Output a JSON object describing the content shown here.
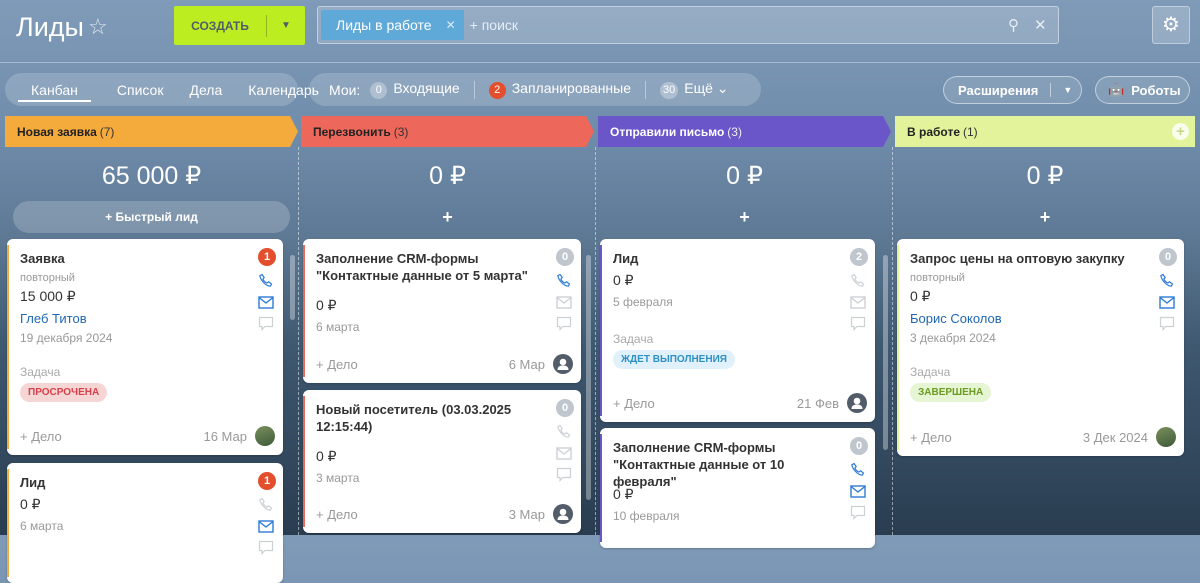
{
  "header": {
    "title": "Лиды",
    "create_label": "СОЗДАТЬ",
    "filter_chip": "Лиды в работе",
    "search_placeholder": "+ поиск"
  },
  "views": [
    {
      "label": "Канбан",
      "active": true
    },
    {
      "label": "Список"
    },
    {
      "label": "Дела"
    },
    {
      "label": "Календарь"
    }
  ],
  "counters": {
    "label": "Мои:",
    "items": [
      {
        "count": "0",
        "label": "Входящие",
        "color": "#8fa3b8"
      },
      {
        "count": "2",
        "label": "Запланированные",
        "color": "#e34e2d"
      },
      {
        "count": "30",
        "label": "Ещё",
        "color": "#8fa3b8"
      }
    ]
  },
  "toolbar": {
    "extensions": "Расширения",
    "robots": "Роботы"
  },
  "quick_lead": "Быстрый лид",
  "columns": [
    {
      "name": "Новая заявка",
      "count": "(7)",
      "color": "#f4ab3b",
      "sum": "65 000 ₽",
      "cards": [
        {
          "title": "Заявка",
          "count": "1",
          "count_color": "#e34e2d",
          "sub": "повторный",
          "amount": "15 000 ₽",
          "contact": "Глеб Титов",
          "date": "19 декабря 2024",
          "task_label": "Задача",
          "tag": "ПРОСРОЧЕНА",
          "tag_type": "overdue",
          "add": "+ Дело",
          "foot_date": "16 Мар",
          "avatar": "photo",
          "phone": true,
          "mail": true
        },
        {
          "title": "Лид",
          "count": "1",
          "count_color": "#e34e2d",
          "amount": "0 ₽",
          "date": "6 марта",
          "phone": false,
          "mail": true
        }
      ]
    },
    {
      "name": "Перезвонить",
      "count": "(3)",
      "color": "#ee675b",
      "sum": "0 ₽",
      "cards": [
        {
          "title": "Заполнение CRM-формы \"Контактные данные от 5 марта\"",
          "count": "0",
          "count_color": "#c0c6cd",
          "amount": "0 ₽",
          "date": "6 марта",
          "add": "+ Дело",
          "foot_date": "6 Мар",
          "avatar": "user",
          "phone": true,
          "mail": false
        },
        {
          "title": "Новый посетитель (03.03.2025 12:15:44)",
          "count": "0",
          "count_color": "#c0c6cd",
          "amount": "0 ₽",
          "date": "3 марта",
          "add": "+ Дело",
          "foot_date": "3 Мар",
          "avatar": "user",
          "phone": false,
          "mail": false
        }
      ]
    },
    {
      "name": "Отправили письмо",
      "count": "(3)",
      "color": "#6a55c9",
      "sum": "0 ₽",
      "cards": [
        {
          "title": "Лид",
          "count": "2",
          "count_color": "#c0c6cd",
          "amount": "0 ₽",
          "date": "5 февраля",
          "task_label": "Задача",
          "tag": "ЖДЕТ ВЫПОЛНЕНИЯ",
          "tag_type": "pending",
          "add": "+ Дело",
          "foot_date": "21 Фев",
          "avatar": "user",
          "phone": false,
          "mail": false
        },
        {
          "title": "Заполнение CRM-формы \"Контактные данные от 10 февраля\"",
          "count": "0",
          "count_color": "#c0c6cd",
          "amount": "0 ₽",
          "date": "10 февраля",
          "phone": true,
          "mail": true
        }
      ]
    },
    {
      "name": "В работе",
      "count": "(1)",
      "color": "#e2f39b",
      "sum": "0 ₽",
      "cards": [
        {
          "title": "Запрос цены на оптовую закупку",
          "count": "0",
          "count_color": "#c0c6cd",
          "sub": "повторный",
          "amount": "0 ₽",
          "contact": "Борис Соколов",
          "date": "3 декабря 2024",
          "task_label": "Задача",
          "tag": "ЗАВЕРШЕНА",
          "tag_type": "done",
          "add": "+ Дело",
          "foot_date": "3 Дек 2024",
          "avatar": "photo",
          "phone": true,
          "mail": true
        }
      ]
    }
  ]
}
